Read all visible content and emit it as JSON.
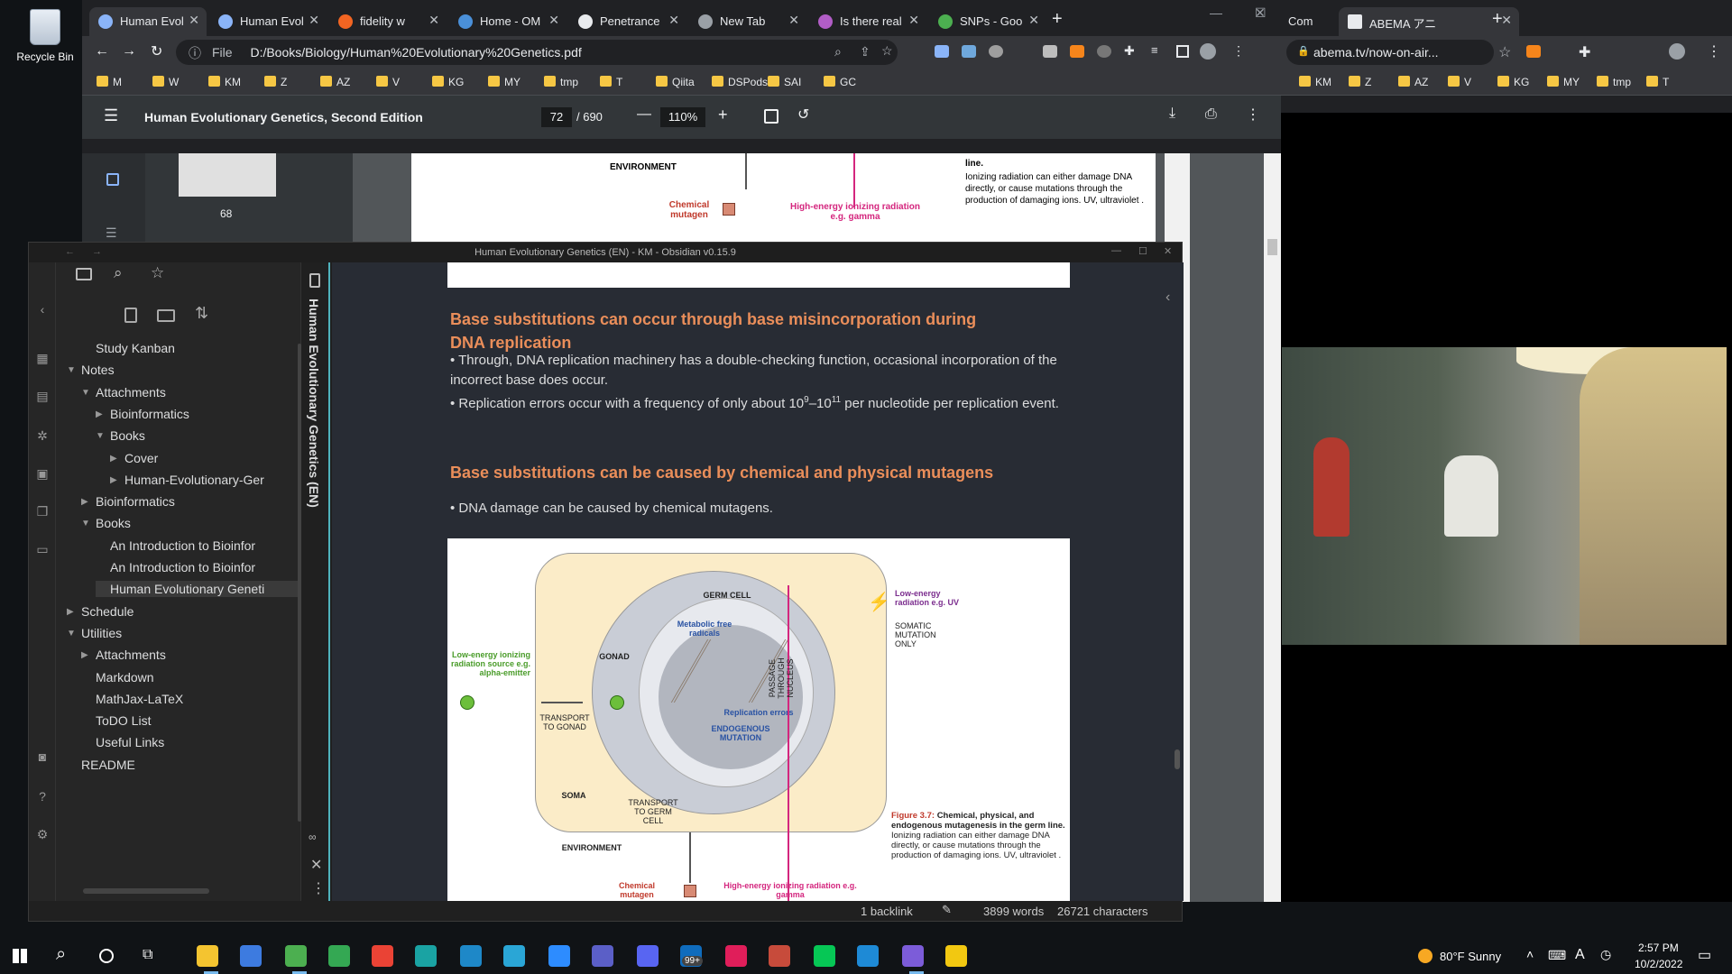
{
  "desktop": {
    "recycle_bin_label": "Recycle Bin"
  },
  "chrome_main": {
    "tabs": [
      {
        "label": "Human Evol",
        "active": true
      },
      {
        "label": "Human Evol"
      },
      {
        "label": "fidelity w"
      },
      {
        "label": "Home - OM"
      },
      {
        "label": "Penetrance"
      },
      {
        "label": "New Tab"
      },
      {
        "label": "Is there real"
      },
      {
        "label": "SNPs - Goo"
      }
    ],
    "address": "D:/Books/Biology/Human%20Evolutionary%20Genetics.pdf",
    "file_label": "File",
    "bookmarks": [
      "M",
      "W",
      "KM",
      "Z",
      "AZ",
      "V",
      "KG",
      "MY",
      "tmp",
      "T",
      "Qiita",
      "DSPods",
      "SAI",
      "GC"
    ],
    "pdf": {
      "title": "Human Evolutionary Genetics, Second Edition",
      "page": "72",
      "total_pages": "/  690",
      "zoom": "110%",
      "thumb_page": "68"
    }
  },
  "pdf_page_fragment": {
    "environment": "ENVIRONMENT",
    "chemical_mutagen": "Chemical mutagen",
    "high_energy": "High-energy ionizing radiation e.g. gamma",
    "caption_tail_bold": "line.",
    "caption_tail": "Ionizing radiation can either damage DNA directly, or cause mutations through the production of damaging ions. UV, ultraviolet ."
  },
  "chrome_right": {
    "tabs": [
      {
        "label": "Com"
      },
      {
        "label": "ABEMA アニ",
        "active": true
      }
    ],
    "address": "abema.tv/now-on-air...",
    "bookmarks": [
      "KM",
      "Z",
      "AZ",
      "V",
      "KG",
      "MY",
      "tmp",
      "T"
    ]
  },
  "obsidian": {
    "title": "Human Evolutionary Genetics (EN) - KM - Obsidian v0.15.9",
    "vertical_tab": "Human Evolutionary Genetics (EN)",
    "tree": [
      {
        "label": "Study Kanban",
        "indent": 1
      },
      {
        "label": "Notes",
        "indent": 0,
        "open": true
      },
      {
        "label": "Attachments",
        "indent": 1,
        "open": true
      },
      {
        "label": "Bioinformatics",
        "indent": 2,
        "closed": true
      },
      {
        "label": "Books",
        "indent": 2,
        "open": true
      },
      {
        "label": "Cover",
        "indent": 3,
        "closed": true
      },
      {
        "label": "Human-Evolutionary-Ger",
        "indent": 3,
        "closed": true
      },
      {
        "label": "Bioinformatics",
        "indent": 1,
        "closed": true
      },
      {
        "label": "Books",
        "indent": 1,
        "open": true
      },
      {
        "label": "An Introduction to Bioinfor",
        "indent": 2
      },
      {
        "label": "An Introduction to Bioinfor",
        "indent": 2
      },
      {
        "label": "Human Evolutionary Geneti",
        "indent": 2,
        "selected": true
      },
      {
        "label": "Schedule",
        "indent": 0,
        "closed": true
      },
      {
        "label": "Utilities",
        "indent": 0,
        "open": true
      },
      {
        "label": "Attachments",
        "indent": 1,
        "closed": true
      },
      {
        "label": "Markdown",
        "indent": 1
      },
      {
        "label": "MathJax-LaTeX",
        "indent": 1
      },
      {
        "label": "ToDO List",
        "indent": 1
      },
      {
        "label": "Useful Links",
        "indent": 1
      },
      {
        "label": "README",
        "indent": 0
      }
    ],
    "content": {
      "heading1": "Base substitutions can occur through base misincorporation during DNA replication",
      "bullet1": "• Through, DNA replication machinery has a double-checking function, occasional incorporation of the incorrect base does occur.",
      "bullet2_pre": "• Replication errors occur with a frequency of only about 10",
      "bullet2_sup1": "9",
      "bullet2_mid": "–10",
      "bullet2_sup2": "11",
      "bullet2_post": " per nucleotide per replication event.",
      "heading2": "Base substitutions can be caused by chemical and physical mutagens",
      "bullet3": "• DNA damage can be caused by chemical mutagens."
    },
    "figure": {
      "germ_cell": "GERM CELL",
      "metabolic": "Metabolic free radicals",
      "gonad": "GONAD",
      "low_energy_alpha": "Low-energy ionizing radiation source e.g. alpha-emitter",
      "transport_gonad": "TRANSPORT TO GONAD",
      "replication_errors": "Replication errors",
      "endogenous": "ENDOGENOUS MUTATION",
      "passage": "PASSAGE THROUGH NUCLEUS",
      "low_energy_uv": "Low-energy radiation e.g. UV",
      "somatic": "SOMATIC MUTATION ONLY",
      "soma": "SOMA",
      "transport_germ": "TRANSPORT TO GERM CELL",
      "environment": "ENVIRONMENT",
      "chemical_mutagen": "Chemical mutagen",
      "high_energy": "High-energy ionizing radiation e.g. gamma",
      "caption_label": "Figure 3.7:",
      "caption_bold": "Chemical, physical, and endogenous mutagenesis in the germ line.",
      "caption_body": "Ionizing radiation can either damage DNA directly, or cause mutations through the production of damaging ions. UV, ultraviolet ."
    },
    "status": {
      "backlinks": "1 backlink",
      "words": "3899 words",
      "characters": "26721 characters"
    }
  },
  "taskbar": {
    "weather": "80°F  Sunny",
    "time": "2:57 PM",
    "date": "10/2/2022",
    "badge": "99+"
  }
}
